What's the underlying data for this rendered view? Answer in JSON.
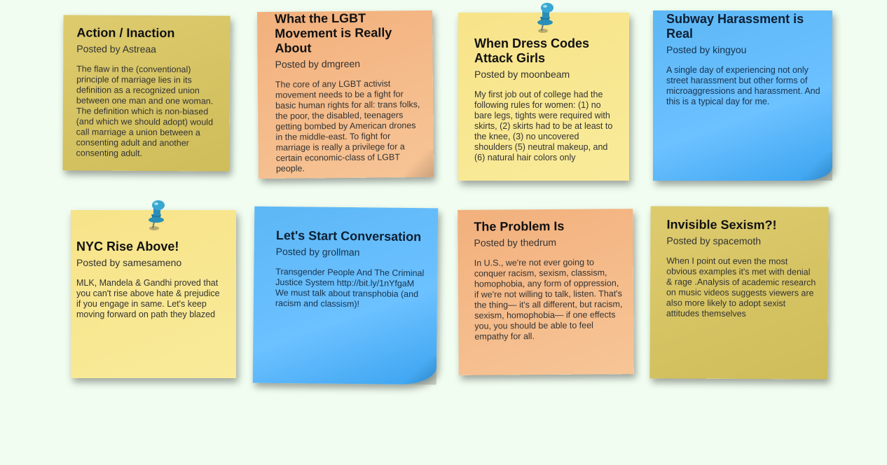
{
  "colors": {
    "background": "#f0fdf0",
    "olive": "#d6c462",
    "orange": "#f5ba88",
    "yellow": "#f8e68f",
    "blue": "#62bbf8",
    "pin": "#2a8fb8"
  },
  "byline_prefix": "Posted by",
  "notes": [
    {
      "title": "Action / Inaction",
      "author": "Astreaa",
      "body": "The flaw in the (conventional) principle of marriage lies in its definition as a recognized union between one man and one woman. The definition which is non-biased (and which we should adopt) would call marriage a union between a consenting adult and another consenting adult."
    },
    {
      "title": "What the LGBT Movement is Really About",
      "author": "dmgreen",
      "body": "The core of any LGBT activist movement needs to be a fight for basic human rights for all: trans folks, the poor, the disabled, teenagers getting bombed by American drones in the middle-east. To fight for marriage is really a privilege for a certain economic-class of LGBT people."
    },
    {
      "title": "When Dress Codes Attack Girls",
      "author": "moonbeam",
      "body": "My first job out of college had the following rules for women: (1) no bare legs, tights were required with skirts, (2) skirts had to be at least to the knee, (3) no uncovered shoulders (5) neutral makeup, and (6) natural hair colors only"
    },
    {
      "title": "Subway Harassment is Real",
      "author": "kingyou",
      "body": "A single day of experiencing not only street harassment but other forms of microaggressions and harassment. And this is a typical day for me."
    },
    {
      "title": "NYC Rise Above!",
      "author": "samesameno",
      "body": "MLK, Mandela & Gandhi proved that you can't rise above hate & prejudice if you engage in same. Let's keep moving forward on path they blazed"
    },
    {
      "title": "Let's Start Conversation",
      "author": "grollman",
      "body": "Transgender People And The Criminal Justice System http://bit.ly/1nYfgaM We must talk about transphobia (and racism and classism)!"
    },
    {
      "title": "The Problem Is",
      "author": "thedrum",
      "body": "In U.S., we're not ever going to conquer racism, sexism, classism, homophobia, any form of oppression, if we're not willing to talk, listen. That's the thing— it's all different, but racism, sexism, homophobia— if one effects you, you should be able to feel empathy for all."
    },
    {
      "title": "Invisible Sexism?!",
      "author": "spacemoth",
      "body": "When I point out even the most obvious examples it's met with denial & rage .Analysis of academic research on music videos suggests viewers are also more likely to adopt sexist attitudes themselves"
    }
  ]
}
